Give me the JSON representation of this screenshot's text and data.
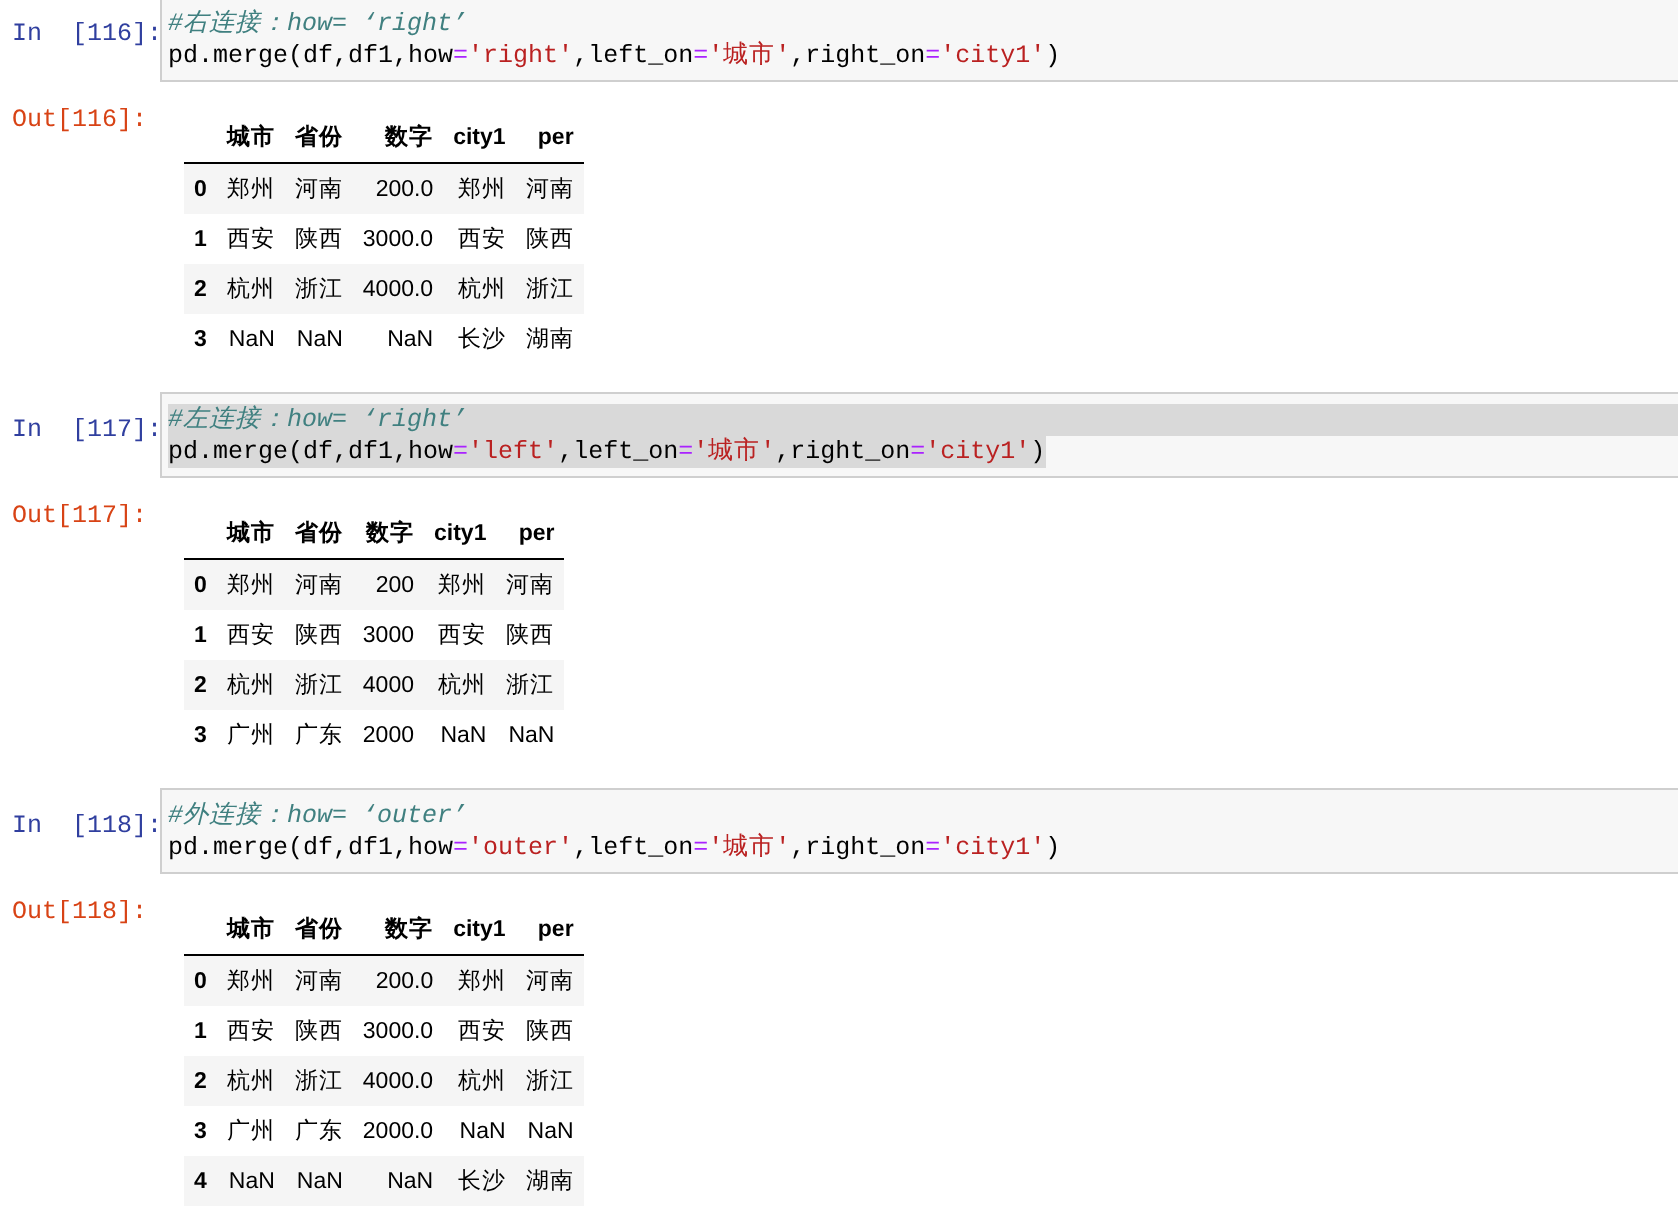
{
  "cells": [
    {
      "in_prompt": "In  [116]:",
      "selected": false,
      "comment": "#右连接：how= ‘right’",
      "code": [
        {
          "kind": "plain",
          "text": "pd.merge(df,df1,how"
        },
        {
          "kind": "op",
          "text": "="
        },
        {
          "kind": "string",
          "text": "'right'"
        },
        {
          "kind": "plain",
          "text": ",left_on"
        },
        {
          "kind": "op",
          "text": "="
        },
        {
          "kind": "string",
          "text": "'城市'"
        },
        {
          "kind": "plain",
          "text": ",right_on"
        },
        {
          "kind": "op",
          "text": "="
        },
        {
          "kind": "string",
          "text": "'city1'"
        },
        {
          "kind": "plain",
          "text": ")"
        }
      ],
      "out_prompt": "Out[116]:",
      "table": {
        "columns": [
          "",
          "城市",
          "省份",
          "数字",
          "city1",
          "per"
        ],
        "rows": [
          [
            "0",
            "郑州",
            "河南",
            "200.0",
            "郑州",
            "河南"
          ],
          [
            "1",
            "西安",
            "陕西",
            "3000.0",
            "西安",
            "陕西"
          ],
          [
            "2",
            "杭州",
            "浙江",
            "4000.0",
            "杭州",
            "浙江"
          ],
          [
            "3",
            "NaN",
            "NaN",
            "NaN",
            "长沙",
            "湖南"
          ]
        ]
      }
    },
    {
      "in_prompt": "In  [117]:",
      "selected": true,
      "comment": "#左连接：how= ‘right’",
      "code": [
        {
          "kind": "plain",
          "text": "pd.merge(df,df1,how"
        },
        {
          "kind": "op",
          "text": "="
        },
        {
          "kind": "string",
          "text": "'left'"
        },
        {
          "kind": "plain",
          "text": ",left_on"
        },
        {
          "kind": "op",
          "text": "="
        },
        {
          "kind": "string",
          "text": "'城市'"
        },
        {
          "kind": "plain",
          "text": ",right_on"
        },
        {
          "kind": "op",
          "text": "="
        },
        {
          "kind": "string",
          "text": "'city1'"
        },
        {
          "kind": "plain",
          "text": ")"
        }
      ],
      "out_prompt": "Out[117]:",
      "table": {
        "columns": [
          "",
          "城市",
          "省份",
          "数字",
          "city1",
          "per"
        ],
        "rows": [
          [
            "0",
            "郑州",
            "河南",
            "200",
            "郑州",
            "河南"
          ],
          [
            "1",
            "西安",
            "陕西",
            "3000",
            "西安",
            "陕西"
          ],
          [
            "2",
            "杭州",
            "浙江",
            "4000",
            "杭州",
            "浙江"
          ],
          [
            "3",
            "广州",
            "广东",
            "2000",
            "NaN",
            "NaN"
          ]
        ]
      }
    },
    {
      "in_prompt": "In  [118]:",
      "selected": false,
      "comment": "#外连接：how= ‘outer’",
      "code": [
        {
          "kind": "plain",
          "text": "pd.merge(df,df1,how"
        },
        {
          "kind": "op",
          "text": "="
        },
        {
          "kind": "string",
          "text": "'outer'"
        },
        {
          "kind": "plain",
          "text": ",left_on"
        },
        {
          "kind": "op",
          "text": "="
        },
        {
          "kind": "string",
          "text": "'城市'"
        },
        {
          "kind": "plain",
          "text": ",right_on"
        },
        {
          "kind": "op",
          "text": "="
        },
        {
          "kind": "string",
          "text": "'city1'"
        },
        {
          "kind": "plain",
          "text": ")"
        }
      ],
      "out_prompt": "Out[118]:",
      "table": {
        "columns": [
          "",
          "城市",
          "省份",
          "数字",
          "city1",
          "per"
        ],
        "rows": [
          [
            "0",
            "郑州",
            "河南",
            "200.0",
            "郑州",
            "河南"
          ],
          [
            "1",
            "西安",
            "陕西",
            "3000.0",
            "西安",
            "陕西"
          ],
          [
            "2",
            "杭州",
            "浙江",
            "4000.0",
            "杭州",
            "浙江"
          ],
          [
            "3",
            "广州",
            "广东",
            "2000.0",
            "NaN",
            "NaN"
          ],
          [
            "4",
            "NaN",
            "NaN",
            "NaN",
            "长沙",
            "湖南"
          ]
        ]
      }
    }
  ]
}
